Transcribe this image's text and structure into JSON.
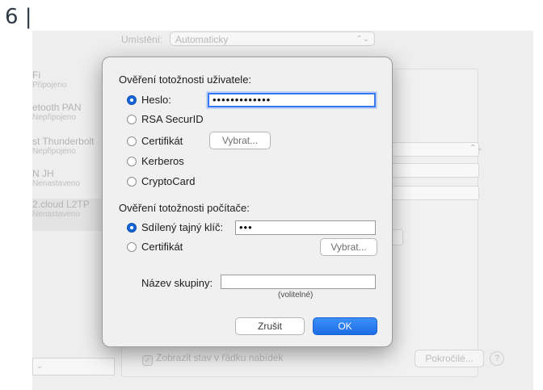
{
  "step_number": "6 |",
  "background": {
    "location_label": "Umístění:",
    "location_value": "Automaticky",
    "services": [
      {
        "name": "Fi",
        "status": "Připojeno"
      },
      {
        "name": "etooth PAN",
        "status": "Nepřipojeno"
      },
      {
        "name": "st Thunderbolt",
        "status": "Nepřipojeno"
      },
      {
        "name": "N JH",
        "status": "Nenastaveno"
      },
      {
        "name": "2.cloud L2TP",
        "status": "Nenastaveno"
      }
    ],
    "show_status_checkbox": "Zobrazit stav v řádku nabídek",
    "advanced_button": "Pokročilé...",
    "help_button": "?"
  },
  "dialog": {
    "user_auth_title": "Ověření totožnosti uživatele:",
    "user_auth_options": [
      {
        "label": "Heslo:",
        "selected": true
      },
      {
        "label": "RSA SecurID",
        "selected": false
      },
      {
        "label": "Certifikát",
        "selected": false
      },
      {
        "label": "Kerberos",
        "selected": false
      },
      {
        "label": "CryptoCard",
        "selected": false
      }
    ],
    "password_value": "•••••••••••••",
    "select_cert_button_1": "Vybrat...",
    "machine_auth_title": "Ověření totožnosti počítače:",
    "machine_auth_options": [
      {
        "label": "Sdílený tajný klíč:",
        "selected": true
      },
      {
        "label": "Certifikát",
        "selected": false
      }
    ],
    "shared_secret_value": "•••",
    "select_cert_button_2": "Vybrat...",
    "group_name_label": "Název skupiny:",
    "group_name_value": "",
    "optional_hint": "(volitelné)",
    "cancel_button": "Zrušit",
    "ok_button": "OK"
  },
  "colors": {
    "accent": "#1565d8",
    "focus_ring": "#3478f6"
  }
}
